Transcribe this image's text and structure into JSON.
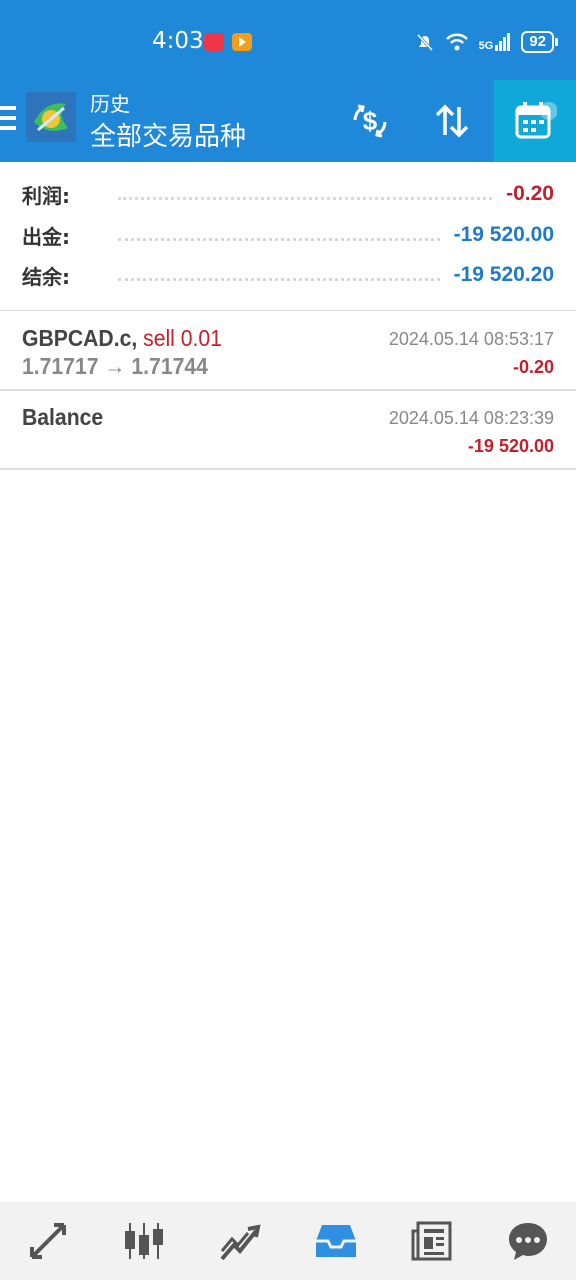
{
  "status": {
    "time": "4:03",
    "network": "5G",
    "battery": "92"
  },
  "appbar": {
    "title_small": "历史",
    "title_main": "全部交易品种"
  },
  "summary": {
    "profit_label": "利润:",
    "profit_value": "-0.20",
    "withdraw_label": "出金:",
    "withdraw_value": "-19 520.00",
    "balance_label": "结余:",
    "balance_value": "-19 520.20"
  },
  "entries": [
    {
      "symbol": "GBPCAD.c,",
      "side": "sell 0.01",
      "prices": "1.71717 → 1.71744",
      "time": "2024.05.14 08:53:17",
      "profit": "-0.20"
    },
    {
      "symbol": "Balance",
      "time": "2024.05.14 08:23:39",
      "profit": "-19 520.00"
    }
  ],
  "colors": {
    "header": "#1f88d9",
    "active_tab": "#0fa8d8",
    "negative": "#c4202c",
    "value_blue": "#1f7bc8",
    "nav_active": "#2f8fe0",
    "nav_inactive": "#555555"
  },
  "icons": {
    "appbar": [
      "dollar-exchange-icon",
      "sort-arrows-icon",
      "calendar-icon"
    ],
    "nav": [
      "trade-arrows-icon",
      "candlestick-icon",
      "chart-trend-icon",
      "inbox-history-icon",
      "news-icon",
      "chat-icon"
    ]
  }
}
